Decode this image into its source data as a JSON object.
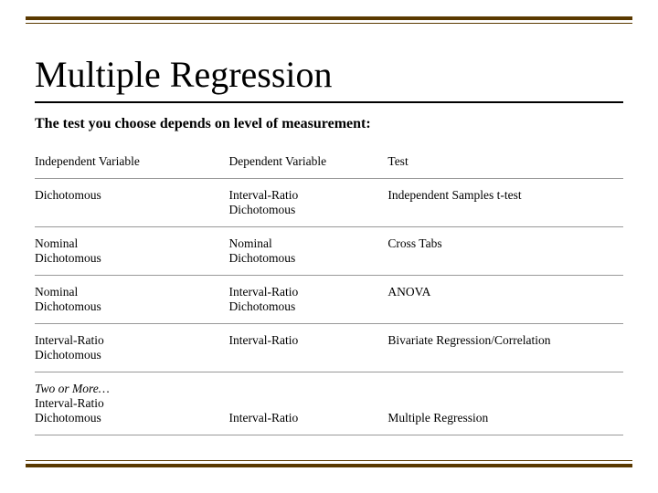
{
  "title": "Multiple Regression",
  "subtitle": "The test you choose depends on level of measurement:",
  "headers": {
    "iv": "Independent Variable",
    "dv": "Dependent   Variable",
    "test": "Test"
  },
  "rows": [
    {
      "iv": "Dichotomous",
      "dv": "Interval-Ratio\nDichotomous",
      "test": "Independent Samples t-test"
    },
    {
      "iv": "Nominal\nDichotomous",
      "dv": "Nominal\nDichotomous",
      "test": "Cross Tabs"
    },
    {
      "iv": "Nominal\nDichotomous",
      "dv": "Interval-Ratio\nDichotomous",
      "test": "ANOVA"
    },
    {
      "iv": "Interval-Ratio\nDichotomous",
      "dv": "Interval-Ratio",
      "test": "Bivariate Regression/Correlation"
    },
    {
      "iv_prefix": "Two or More…",
      "iv": "Interval-Ratio\nDichotomous",
      "dv": "Interval-Ratio",
      "test": "Multiple Regression"
    }
  ]
}
